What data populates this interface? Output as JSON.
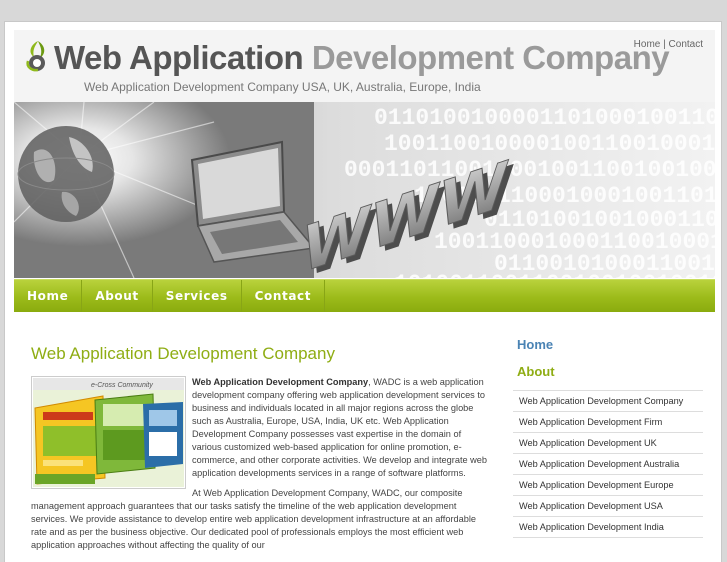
{
  "header": {
    "title_part1": "Web Application",
    "title_part2": "Development Company",
    "tagline": "Web Application Development Company USA, UK, Australia, Europe, India",
    "top_links": {
      "home": "Home",
      "separator": "|",
      "contact": "Contact"
    }
  },
  "hero": {
    "binary_rows": [
      "0110100100001101000100110",
      "10011001000010011001000110",
      "0001101100100010011001001001",
      "10010011000100010011010110",
      "01101001001000110100100110",
      "1001100010001100100010011",
      "0110010100011001001001000",
      "1010011001100100100100101"
    ],
    "www_text": "WWW"
  },
  "nav": {
    "items": [
      "Home",
      "About",
      "Services",
      "Contact"
    ]
  },
  "main": {
    "heading": "Web Application Development Company",
    "thumb_caption": "e-Cross Community",
    "p1_bold": "Web Application Development Company",
    "p1_rest": ", WADC is a web application development company offering web application development services to business and individuals located in all major regions across the globe such as Australia, Europe, USA, India, UK etc. Web Application Development Company possesses vast expertise in the domain of various customized web-based application for online promotion, e-commerce, and other corporate activities. We develop and integrate web application developments services in a range of software platforms.",
    "p2": "At Web Application Development Company, WADC, our composite management approach guarantees that our tasks satisfy the timeline of the web application development services. We provide assistance to develop entire web application development infrastructure at an affordable rate and as per the business objective. Our dedicated pool of professionals employs the most efficient web application approaches without affecting the quality of our"
  },
  "sidebar": {
    "home": "Home",
    "about": "About",
    "links": [
      "Web Application Development Company",
      "Web Application Development Firm",
      "Web Application Development UK",
      "Web Application Development Australia",
      "Web Application Development Europe",
      "Web Application Development USA",
      "Web Application Development India"
    ]
  },
  "colors": {
    "accent_green": "#9cbb1a",
    "heading_blue": "#4a83b4",
    "title_dark": "#555555",
    "title_light": "#9a9a9a"
  }
}
